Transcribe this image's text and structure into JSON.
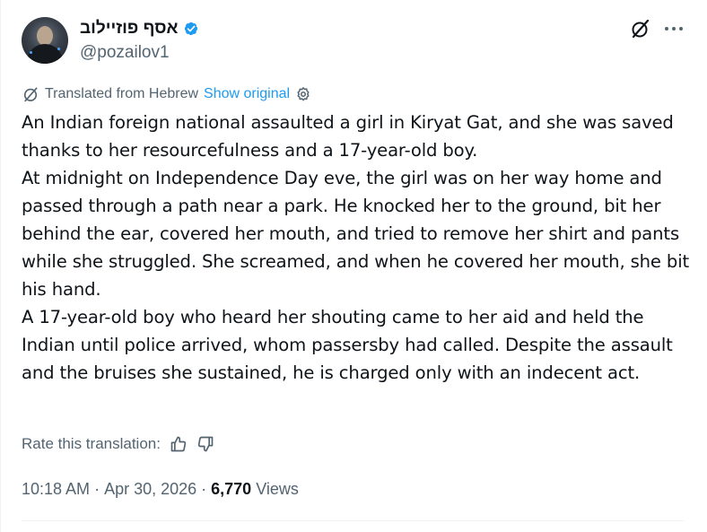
{
  "author": {
    "display_name": "אסף פוזיילוב",
    "handle": "@pozailov1",
    "verified_color": "#1d9bf0"
  },
  "translation": {
    "translated_from": "Translated from Hebrew",
    "show_original": "Show original",
    "rate_label": "Rate this translation:"
  },
  "tweet": {
    "paragraphs": [
      "An Indian foreign national assaulted a girl in Kiryat Gat, and she was saved thanks to her resourcefulness and a 17-year-old boy.",
      "At midnight on Independence Day eve, the girl was on her way home and passed through a path near a park. He knocked her to the ground, bit her behind the ear, covered her mouth, and tried to remove her shirt and pants while she struggled. She screamed, and when he covered her mouth, she bit his hand.",
      "A 17-year-old boy who heard her shouting came to her aid and held the Indian until police arrived, whom passersby had called. Despite the assault and the bruises she sustained, he is charged only with an indecent act."
    ],
    "time": "10:18 AM",
    "separator": "·",
    "date": "Apr 30, 2026",
    "views_count": "6,770",
    "views_label": "Views"
  },
  "icons": {
    "grok": "grok-slash-icon",
    "more": "more-dots-icon",
    "translate": "translate-icon",
    "settings": "gear-icon",
    "thumbs_up": "thumbs-up-icon",
    "thumbs_down": "thumbs-down-icon"
  }
}
